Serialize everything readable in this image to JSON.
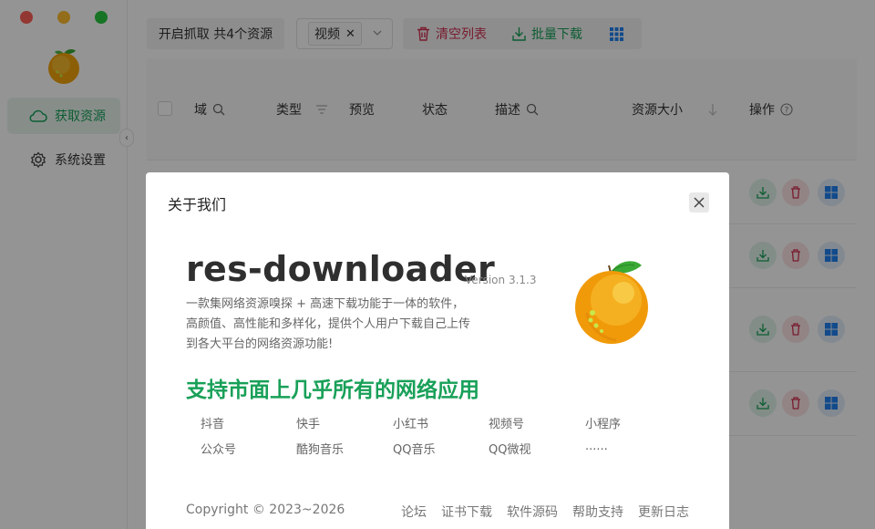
{
  "sidebar": {
    "items": [
      {
        "label": "获取资源",
        "icon": "cloud-icon"
      },
      {
        "label": "系统设置",
        "icon": "gear-icon"
      }
    ]
  },
  "toolbar": {
    "capture_label": "开启抓取 共4个资源",
    "filter_tag": "视频",
    "clear_label": "清空列表",
    "batch_download_label": "批量下载"
  },
  "table": {
    "headers": {
      "domain": "域",
      "type": "类型",
      "preview": "预览",
      "status": "状态",
      "description": "描述",
      "size": "资源大小",
      "actions": "操作"
    }
  },
  "modal": {
    "title": "关于我们",
    "app_name": "res-downloader",
    "version": "Version 3.1.3",
    "description": "一款集网络资源嗅探 + 高速下载功能于一体的软件，高颜值、高性能和多样化，提供个人用户下载自己上传到各大平台的网络资源功能!",
    "slogan": "支持市面上几乎所有的网络应用",
    "platforms": [
      "抖音",
      "快手",
      "小红书",
      "视频号",
      "小程序",
      "公众号",
      "酷狗音乐",
      "QQ音乐",
      "QQ微视",
      "......"
    ],
    "copyright": "Copyright © 2023~2026",
    "links": [
      "论坛",
      "证书下载",
      "软件源码",
      "帮助支持",
      "更新日志"
    ]
  },
  "colors": {
    "accent": "#18a058",
    "danger": "#d03050",
    "info": "#2080f0"
  }
}
